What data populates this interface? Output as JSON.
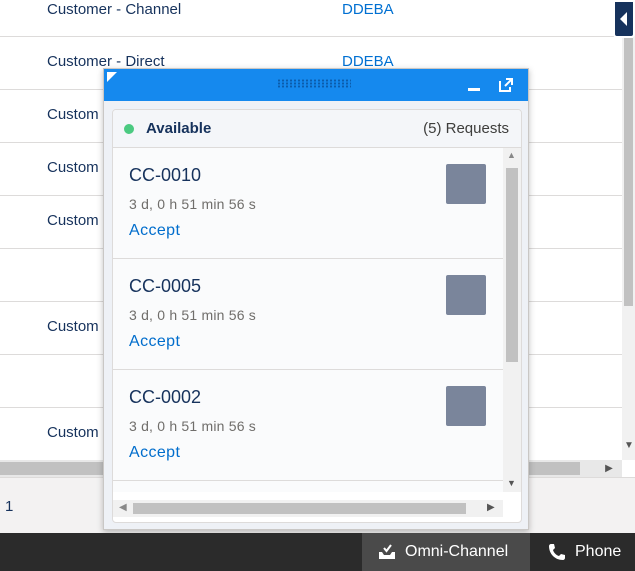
{
  "background_table": {
    "rows": [
      {
        "name": "Customer - Channel",
        "owner": "DDEBA"
      },
      {
        "name": "Customer - Direct",
        "owner": "DDEBA"
      },
      {
        "name": "Custom",
        "owner": ""
      },
      {
        "name": "Custom",
        "owner": ""
      },
      {
        "name": "Custom",
        "owner": ""
      },
      {
        "name": "",
        "owner": ""
      },
      {
        "name": "Custom",
        "owner": ""
      },
      {
        "name": "",
        "owner": ""
      },
      {
        "name": "Custom",
        "owner": ""
      }
    ]
  },
  "footer": {
    "page_number": "1"
  },
  "omni_channel": {
    "status": "Available",
    "requests_label": "(5) Requests",
    "work_items": [
      {
        "title": "CC-0010",
        "time": "3 d, 0 h 51 min 56 s",
        "accept_label": "Accept"
      },
      {
        "title": "CC-0005",
        "time": "3 d, 0 h 51 min 56 s",
        "accept_label": "Accept"
      },
      {
        "title": "CC-0002",
        "time": "3 d, 0 h 51 min 56 s",
        "accept_label": "Accept"
      },
      {
        "title": "",
        "time": "",
        "accept_label": ""
      }
    ]
  },
  "utility_bar": {
    "omni_channel_label": "Omni-Channel",
    "phone_label": "Phone"
  },
  "colors": {
    "panel_header": "#1589ee",
    "available_dot": "#4bca81",
    "link": "#006dcc",
    "utility_bar": "#2b2b2b"
  },
  "icons": {
    "omni_channel": "inbox-tray-icon",
    "phone": "phone-icon",
    "minimize": "minimize-icon",
    "popout": "popout-icon"
  }
}
